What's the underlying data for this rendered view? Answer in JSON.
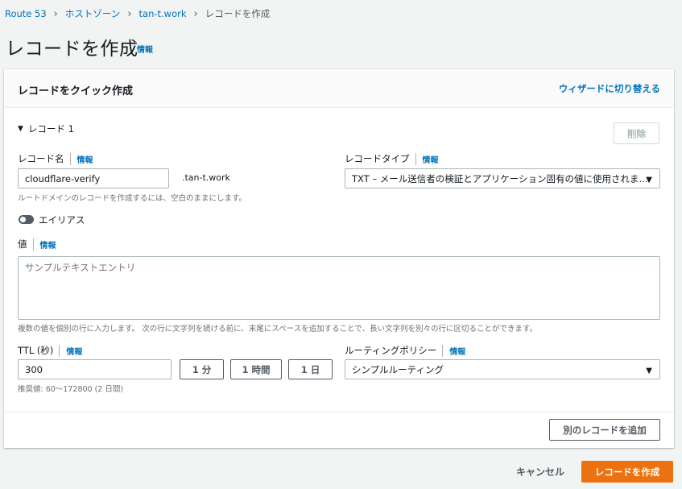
{
  "breadcrumb": {
    "items": [
      "Route 53",
      "ホストゾーン",
      "tan-t.work"
    ],
    "current": "レコードを作成"
  },
  "page": {
    "title": "レコードを作成",
    "info": "情報"
  },
  "panel": {
    "title": "レコードをクイック作成",
    "wizard_link": "ウィザードに切り替える",
    "record_section": "レコード 1",
    "delete_button": "削除",
    "record_name": {
      "label": "レコード名",
      "info": "情報",
      "value": "cloudflare-verify",
      "suffix": ".tan-t.work",
      "hint": "ルートドメインのレコードを作成するには、空白のままにします。"
    },
    "record_type": {
      "label": "レコードタイプ",
      "info": "情報",
      "value": "TXT – メール送信者の検証とアプリケーション固有の値に使用されま..."
    },
    "alias": {
      "label": "エイリアス"
    },
    "value_field": {
      "label": "値",
      "info": "情報",
      "placeholder": "サンプルテキストエントリ",
      "hint": "複数の値を個別の行に入力します。 次の行に文字列を続ける前に、末尾にスペースを追加することで、長い文字列を別々の行に区切ることができます。"
    },
    "ttl": {
      "label": "TTL (秒)",
      "info": "情報",
      "value": "300",
      "hint": "推奨値: 60～172800 (2 日間)",
      "presets": [
        "1 分",
        "1 時間",
        "1 日"
      ]
    },
    "routing_policy": {
      "label": "ルーティングポリシー",
      "info": "情報",
      "value": "シンプルルーティング"
    },
    "add_record_button": "別のレコードを追加"
  },
  "footer": {
    "cancel": "キャンセル",
    "create": "レコードを作成"
  },
  "colors": {
    "link": "#0073bb",
    "primary": "#ec7211",
    "background": "#f2f3f3"
  }
}
